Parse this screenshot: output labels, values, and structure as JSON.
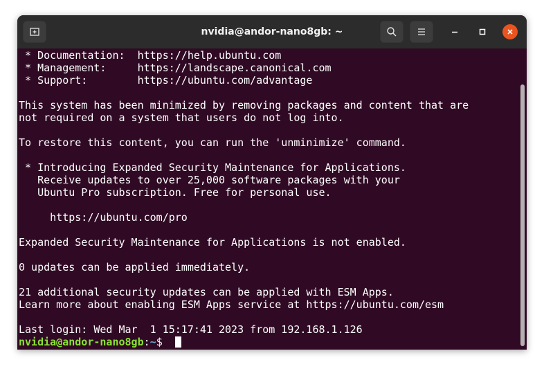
{
  "window": {
    "title": "nvidia@andor-nano8gb: ~"
  },
  "toolbar": {
    "new_tab_icon": "new-tab-icon",
    "search_icon": "search-icon",
    "menu_icon": "hamburger-menu-icon",
    "minimize_icon": "minimize-icon",
    "maximize_icon": "maximize-icon",
    "close_icon": "close-icon"
  },
  "colors": {
    "terminal_bg": "#300a24",
    "titlebar_bg": "#2c2c2c",
    "prompt_user": "#8ae234",
    "prompt_path": "#729fcf",
    "close_button": "#e95420"
  },
  "terminal": {
    "lines": [
      " * Documentation:  https://help.ubuntu.com",
      " * Management:     https://landscape.canonical.com",
      " * Support:        https://ubuntu.com/advantage",
      "",
      "This system has been minimized by removing packages and content that are",
      "not required on a system that users do not log into.",
      "",
      "To restore this content, you can run the 'unminimize' command.",
      "",
      " * Introducing Expanded Security Maintenance for Applications.",
      "   Receive updates to over 25,000 software packages with your",
      "   Ubuntu Pro subscription. Free for personal use.",
      "",
      "     https://ubuntu.com/pro",
      "",
      "Expanded Security Maintenance for Applications is not enabled.",
      "",
      "0 updates can be applied immediately.",
      "",
      "21 additional security updates can be applied with ESM Apps.",
      "Learn more about enabling ESM Apps service at https://ubuntu.com/esm",
      "",
      "Last login: Wed Mar  1 15:17:41 2023 from 192.168.1.126"
    ],
    "prompt": {
      "user_host": "nvidia@andor-nano8gb",
      "separator": ":",
      "path": "~",
      "sign": "$ "
    }
  }
}
